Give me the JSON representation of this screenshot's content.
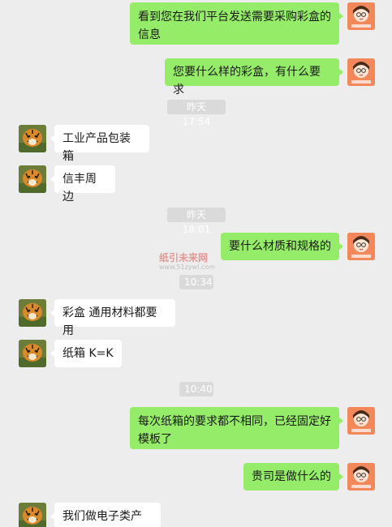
{
  "messages": [
    {
      "text": "看到您在我们平台发送需要采购彩盒的信息"
    },
    {
      "text": "您要什么样的彩盒，有什么要求"
    },
    {
      "text": "工业产品包装箱"
    },
    {
      "text": "信丰周边"
    },
    {
      "text": "要什么材质和规格的"
    },
    {
      "text": "彩盒 通用材料都要用"
    },
    {
      "text": "纸箱 K=K"
    },
    {
      "text": "每次纸箱的要求都不相同，已经固定好模板了"
    },
    {
      "text": "贵司是做什么的"
    },
    {
      "text": "我们做电子类产品"
    }
  ],
  "timestamps": [
    "昨天 17:54",
    "昨天 18:01",
    "10:34",
    "10:40"
  ],
  "watermark": {
    "line1": "纸引未来网",
    "line2": "www.51zywl.com"
  },
  "colors": {
    "my_bubble": "#95ec69",
    "their_bubble": "#ffffff",
    "background": "#ededed",
    "my_avatar": "#f2885a"
  }
}
